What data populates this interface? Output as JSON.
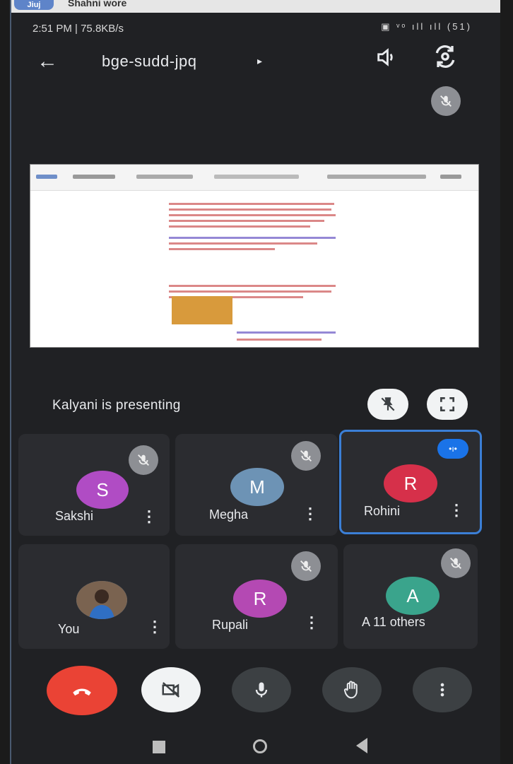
{
  "notification": {
    "app_pill": "Jiuj",
    "sender": "Shahni wore"
  },
  "status": {
    "time": "2:51 PM | 75.8KB/s",
    "icons": "▣ ᵛᵒ ıll ıll (51)"
  },
  "meeting": {
    "code": "bge-sudd-jpq",
    "code_caret": "▸"
  },
  "presentation": {
    "presenter": "Kalyani is presenting"
  },
  "participants": [
    {
      "name": "Sakshi",
      "initial": "S",
      "color": "#b04cc4",
      "muted": true,
      "active": false
    },
    {
      "name": "Megha",
      "initial": "M",
      "color": "#6d93b5",
      "muted": true,
      "active": false
    },
    {
      "name": "Rohini",
      "initial": "R",
      "color": "#d6304a",
      "muted": false,
      "active": true
    },
    {
      "name": "You",
      "initial": "",
      "color": "#4b86b9",
      "muted": false,
      "active": false
    },
    {
      "name": "Rupali",
      "initial": "R",
      "color": "#b449b3",
      "muted": true,
      "active": false
    },
    {
      "name": "A 11 others",
      "initial": "A",
      "color": "#3aa48c",
      "muted": true,
      "active": false
    }
  ],
  "colors": {
    "background": "#202124",
    "tile": "#2b2c30",
    "end_call": "#ea4335",
    "active_border": "#3b7fd6",
    "badge": "#1a73e8"
  },
  "icons": {
    "back": "arrow-left",
    "speaker": "speaker-icon",
    "switch_camera": "camera-rotate-icon",
    "mic_off": "mic-off-icon",
    "pin": "pin-off-icon",
    "fullscreen": "fullscreen-icon",
    "end_call": "phone-hangup-icon",
    "camera_off": "video-off-icon",
    "mic": "mic-icon",
    "hand": "raise-hand-icon",
    "more": "more-vertical-icon"
  }
}
